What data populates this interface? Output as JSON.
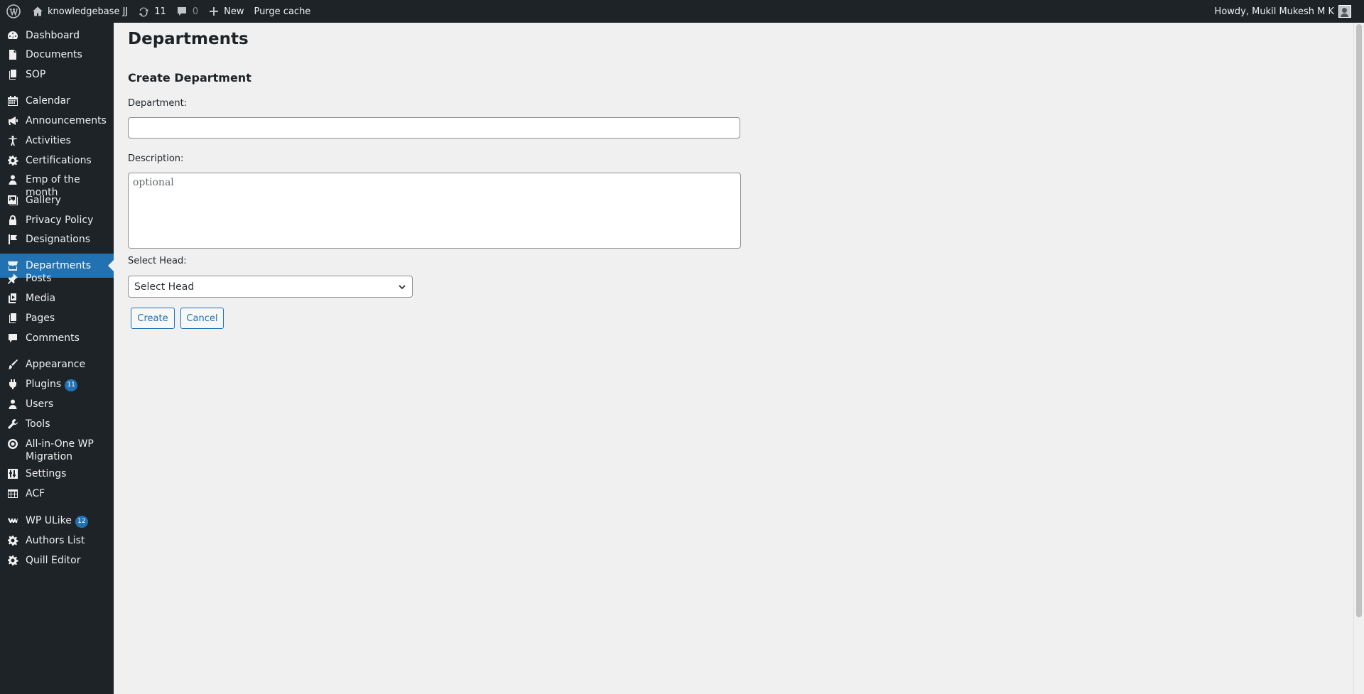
{
  "adminbar": {
    "site_name": "knowledgebase JJ",
    "updates_count": "11",
    "comments_count": "0",
    "new_label": "New",
    "purge_label": "Purge cache",
    "howdy": "Howdy, Mukil Mukesh M K"
  },
  "sidebar": {
    "items": [
      {
        "label": "Dashboard",
        "icon": "dashboard-icon"
      },
      {
        "label": "Documents",
        "icon": "document-icon"
      },
      {
        "label": "SOP",
        "icon": "pages-icon"
      },
      {
        "label": "Calendar",
        "icon": "calendar-icon"
      },
      {
        "label": "Announcements",
        "icon": "megaphone-icon"
      },
      {
        "label": "Activities",
        "icon": "universal-access-icon"
      },
      {
        "label": "Certifications",
        "icon": "gear-icon"
      },
      {
        "label": "Emp of the month",
        "icon": "user-icon"
      },
      {
        "label": "Gallery",
        "icon": "gallery-icon"
      },
      {
        "label": "Privacy Policy",
        "icon": "lock-icon"
      },
      {
        "label": "Designations",
        "icon": "flag-icon"
      },
      {
        "label": "Departments",
        "icon": "store-icon"
      },
      {
        "label": "Posts",
        "icon": "pin-icon"
      },
      {
        "label": "Media",
        "icon": "media-icon"
      },
      {
        "label": "Pages",
        "icon": "pages-icon"
      },
      {
        "label": "Comments",
        "icon": "comment-icon"
      },
      {
        "label": "Appearance",
        "icon": "brush-icon"
      },
      {
        "label": "Plugins",
        "icon": "plugin-icon",
        "badge": "11"
      },
      {
        "label": "Users",
        "icon": "user-icon"
      },
      {
        "label": "Tools",
        "icon": "wrench-icon"
      },
      {
        "label": "All-in-One WP Migration",
        "icon": "migration-icon"
      },
      {
        "label": "Settings",
        "icon": "settings-icon"
      },
      {
        "label": "ACF",
        "icon": "table-icon"
      },
      {
        "label": "WP ULike",
        "icon": "ulike-icon",
        "badge": "12"
      },
      {
        "label": "Authors List",
        "icon": "gear-icon"
      },
      {
        "label": "Quill Editor",
        "icon": "gear-icon"
      }
    ]
  },
  "main": {
    "title": "Departments",
    "section_title": "Create Department",
    "department_label": "Department:",
    "department_value": "",
    "description_label": "Description:",
    "description_placeholder": "optional",
    "head_label": "Select Head:",
    "head_selected": "Select Head",
    "create_label": "Create",
    "cancel_label": "Cancel"
  },
  "colors": {
    "adminbar_bg": "#1d2327",
    "accent": "#2271b1",
    "page_bg": "#f0f0f1"
  }
}
